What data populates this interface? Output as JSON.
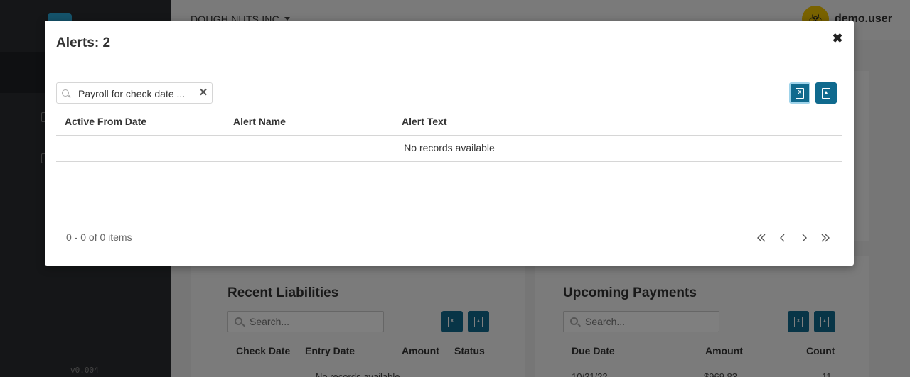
{
  "app": {
    "version": "v0.004",
    "company": "DOUGH NUTS INC.",
    "user_name": "demo.user"
  },
  "recent_liabilities": {
    "title": "Recent Liabilities",
    "search_placeholder": "Search...",
    "columns": [
      "Check Date",
      "Entry Date",
      "Amount",
      "Status"
    ],
    "empty_text": "No records available"
  },
  "upcoming_payments": {
    "title": "Upcoming Payments",
    "search_placeholder": "Search...",
    "columns": [
      "Due Date",
      "Amount",
      "Count"
    ],
    "rows": [
      {
        "due_date": "10/31/22",
        "amount": "$969.83",
        "count": "11"
      }
    ]
  },
  "modal": {
    "title": "Alerts: 2",
    "close_icon": "close-icon",
    "search_value": "Payroll for check date ...",
    "columns": [
      "Active From Date",
      "Alert Name",
      "Alert Text"
    ],
    "empty_text": "No records available",
    "pager_info": "0 - 0 of 0 items",
    "export_excel_icon": "excel-icon",
    "export_pdf_icon": "pdf-icon"
  },
  "colors": {
    "accent": "#106a8e",
    "sidebar": "#2b2d31",
    "avatar": "#f2c500"
  }
}
